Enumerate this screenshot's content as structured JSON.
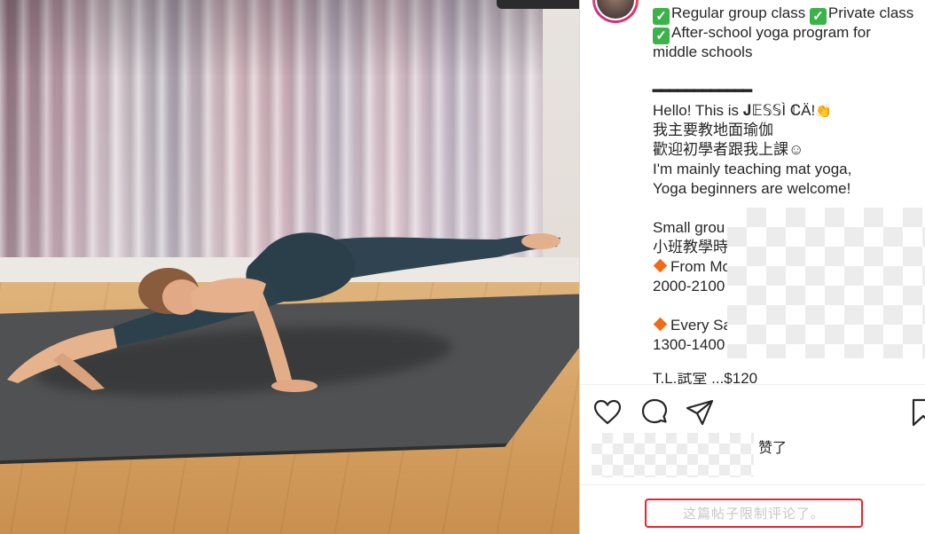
{
  "caption": {
    "lines": [
      "Regular group class ",
      "Private class",
      "After-school yoga program for",
      "middle schools",
      "━━━━━━━━━━━━",
      "Hello! This is 𝐉𝔼𝕊𝕊Ì ℂÄ!",
      "我主要教地面瑜伽",
      "歡迎初學者跟我上課☺",
      "I'm mainly teaching mat yoga,",
      "Yoga beginners are welcome!",
      "Small grou",
      "小班教學時",
      "From Mo",
      "2000-2100",
      "Every Sa",
      "1300-1400",
      "T.L.試堂 ...$120"
    ]
  },
  "icons": {
    "check": "white-check-mark-icon",
    "diamond": "orange-diamond-icon",
    "clap": "clapping-hands-icon",
    "like": "heart-icon",
    "comment": "comment-bubble-icon",
    "share": "paper-plane-icon",
    "save": "bookmark-icon"
  },
  "likes": {
    "label": "赞了"
  },
  "comments": {
    "limited_notice": "这篇帖子限制评论了。"
  },
  "colors": {
    "check_green": "#3cb34a",
    "diamond_orange": "#f26a16",
    "highlight_red": "#e8242c",
    "muted_text": "#c7c7c7"
  }
}
